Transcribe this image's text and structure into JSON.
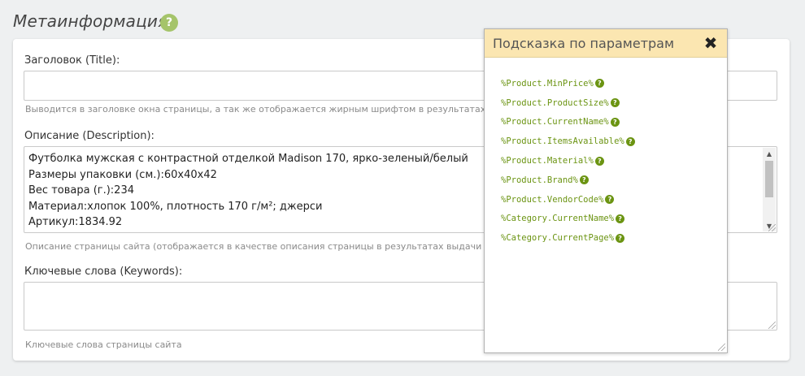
{
  "section": {
    "title": "Метаинформация",
    "help": "?"
  },
  "title_field": {
    "label": "Заголовок (Title):",
    "value": "",
    "hint": "Выводится в заголовке окна страницы, а так же отображается жирным шрифтом в результатах выдачи"
  },
  "description_field": {
    "label": "Описание (Description):",
    "lines": [
      "Футболка мужская с контрастной отделкой Madison 170, ярко-зеленый/белый",
      "Размеры упаковки (см.):60х40х42",
      "Вес товара (г.):234",
      "Материал:хлопок 100%, плотность 170 г/м²; джерси",
      "Артикул:1834.92"
    ],
    "hint": "Описание страницы сайта (отображается в качестве описания страницы в результатах выдачи поисковой"
  },
  "keywords_field": {
    "label": "Ключевые слова (Keywords):",
    "value": "",
    "hint": "Ключевые слова страницы сайта"
  },
  "popup": {
    "title": "Подсказка по параметрам",
    "close_symbol": "✖",
    "params": [
      "%Product.MinPrice%",
      "%Product.ProductSize%",
      "%Product.CurrentName%",
      "%Product.ItemsAvailable%",
      "%Product.Material%",
      "%Product.Brand%",
      "%Product.VendorCode%",
      "%Category.CurrentName%",
      "%Category.CurrentPage%"
    ],
    "help_symbol": "?"
  },
  "colors": {
    "popup_header": "#fbe6b1",
    "param_green": "#6b9412",
    "help_badge": "#a5c46a"
  }
}
